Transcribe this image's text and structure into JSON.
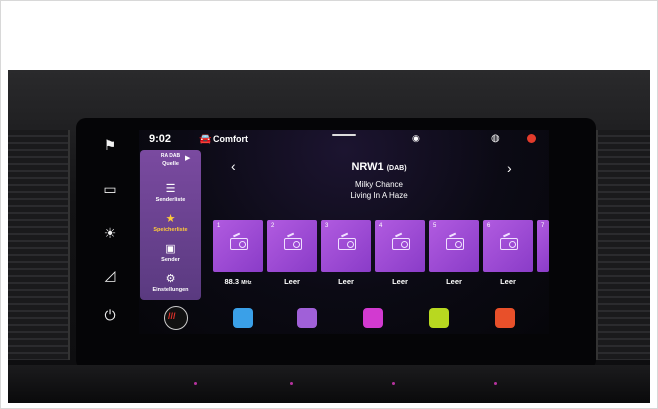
{
  "status": {
    "time": "9:02",
    "profile": "Comfort",
    "icons": [
      "car-icon",
      "wifi-icon",
      "globe-icon",
      "alert-icon"
    ]
  },
  "source_menu": {
    "items": [
      {
        "label": "Quelle",
        "icon": "dab-icon"
      },
      {
        "label": "Senderliste",
        "icon": "list-icon"
      },
      {
        "label": "Speicherliste",
        "icon": "star-icon",
        "active": true
      },
      {
        "label": "Sender",
        "icon": "radio-icon"
      },
      {
        "label": "Einstellungen",
        "icon": "gear-icon"
      }
    ],
    "dab_badge": "RA DAB"
  },
  "now_playing": {
    "station": "NRW1",
    "band": "(DAB)",
    "artist": "Milky Chance",
    "title": "Living In A Haze"
  },
  "presets": [
    {
      "number": "1",
      "label": "88.3",
      "unit": "MHz"
    },
    {
      "number": "2",
      "label": "Leer",
      "unit": ""
    },
    {
      "number": "3",
      "label": "Leer",
      "unit": ""
    },
    {
      "number": "4",
      "label": "Leer",
      "unit": ""
    },
    {
      "number": "5",
      "label": "Leer",
      "unit": ""
    },
    {
      "number": "6",
      "label": "Leer",
      "unit": ""
    },
    {
      "number": "7",
      "label": "",
      "unit": ""
    }
  ],
  "dock": {
    "home_icon": "home-menu-icon",
    "apps": [
      {
        "icon": "navigation-icon",
        "color": "#3aa0e8"
      },
      {
        "icon": "media-icon",
        "color": "#a060d8"
      },
      {
        "icon": "radio-app-icon",
        "color": "#d23ad0"
      },
      {
        "icon": "phone-icon",
        "color": "#b8d820"
      },
      {
        "icon": "car-settings-icon",
        "color": "#e8502a"
      }
    ]
  },
  "hardware_buttons": [
    "flag-icon",
    "screen-icon",
    "brightness-up-icon",
    "brightness-down-icon",
    "power-icon"
  ],
  "colors": {
    "accent_purple": "#9b4fd6",
    "active_yellow": "#ffcb3a",
    "alert_red": "#e23b2b"
  }
}
